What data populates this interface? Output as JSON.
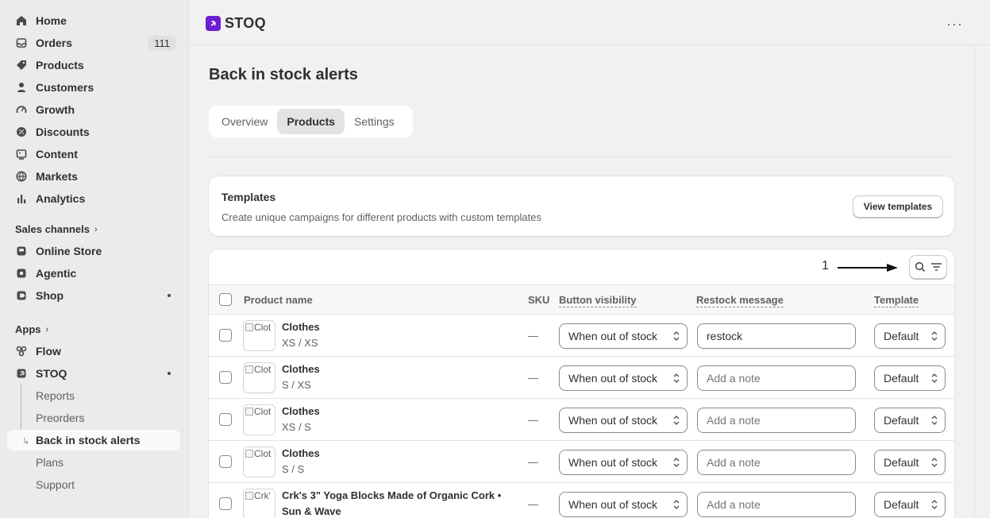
{
  "sidebar": {
    "main": [
      {
        "label": "Home",
        "icon": "home-icon"
      },
      {
        "label": "Orders",
        "icon": "inbox-icon",
        "badge": "111"
      },
      {
        "label": "Products",
        "icon": "tag-icon"
      },
      {
        "label": "Customers",
        "icon": "person-icon"
      },
      {
        "label": "Growth",
        "icon": "gauge-icon"
      },
      {
        "label": "Discounts",
        "icon": "discount-icon"
      },
      {
        "label": "Content",
        "icon": "image-icon"
      },
      {
        "label": "Markets",
        "icon": "globe-icon"
      },
      {
        "label": "Analytics",
        "icon": "bar-chart-icon"
      }
    ],
    "sales_channels_heading": "Sales channels",
    "channels": [
      {
        "label": "Online Store",
        "icon": "store-icon"
      },
      {
        "label": "Agentic",
        "icon": "agentic-icon"
      },
      {
        "label": "Shop",
        "icon": "shop-icon"
      }
    ],
    "apps_heading": "Apps",
    "apps": [
      {
        "label": "Flow",
        "icon": "flow-icon"
      },
      {
        "label": "STOQ",
        "icon": "stoq-icon"
      }
    ],
    "stoq_subitems": [
      "Reports",
      "Preorders",
      "Back in stock alerts",
      "Plans",
      "Support"
    ]
  },
  "topbar": {
    "app_name": "STOQ",
    "more_label": "···"
  },
  "page": {
    "title": "Back in stock alerts",
    "tabs": [
      "Overview",
      "Products",
      "Settings"
    ],
    "active_tab": "Products"
  },
  "templates_card": {
    "title": "Templates",
    "description": "Create unique campaigns for different products with custom templates",
    "button": "View templates"
  },
  "table": {
    "annotation": "1",
    "headers": {
      "product": "Product name",
      "sku": "SKU",
      "visibility": "Button visibility",
      "restock": "Restock message",
      "template": "Template"
    },
    "rows": [
      {
        "thumb_alt": "Clot",
        "name": "Clothes",
        "variant": "XS / XS",
        "sku": "—",
        "visibility": "When out of stock",
        "restock": "restock",
        "restock_placeholder": "",
        "template": "Default"
      },
      {
        "thumb_alt": "Clot",
        "name": "Clothes",
        "variant": "S / XS",
        "sku": "—",
        "visibility": "When out of stock",
        "restock": "",
        "restock_placeholder": "Add a note",
        "template": "Default"
      },
      {
        "thumb_alt": "Clot",
        "name": "Clothes",
        "variant": "XS / S",
        "sku": "—",
        "visibility": "When out of stock",
        "restock": "",
        "restock_placeholder": "Add a note",
        "template": "Default"
      },
      {
        "thumb_alt": "Clot",
        "name": "Clothes",
        "variant": "S / S",
        "sku": "—",
        "visibility": "When out of stock",
        "restock": "",
        "restock_placeholder": "Add a note",
        "template": "Default"
      },
      {
        "thumb_alt": "Crk'",
        "name": "Crk's 3\" Yoga Blocks Made of Organic Cork •",
        "variant": "Sun & Wave",
        "sku": "—",
        "visibility": "When out of stock",
        "restock": "",
        "restock_placeholder": "Add a note",
        "template": "Default"
      }
    ]
  },
  "colors": {
    "accent_purple": "#6c1fd1",
    "sidebar_bg": "#ebebeb",
    "page_bg": "#f1f1f1"
  }
}
